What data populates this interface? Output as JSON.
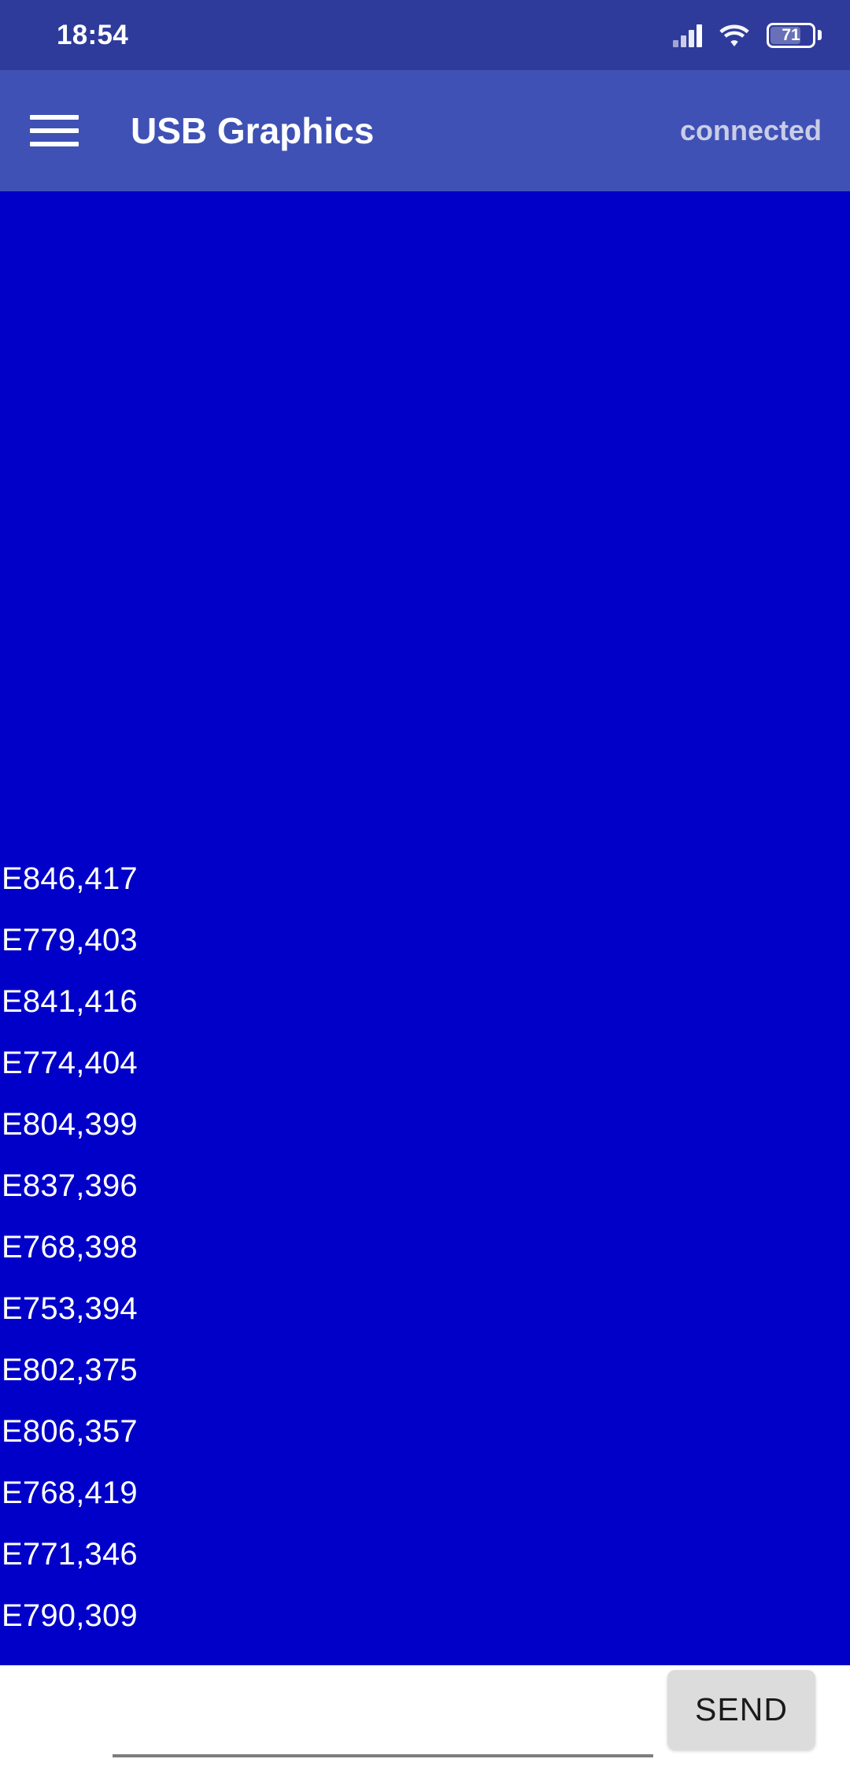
{
  "status_bar": {
    "time": "18:54",
    "battery_level": "71",
    "signal_icon": "signal-bars-icon",
    "wifi_icon": "wifi-icon",
    "battery_icon": "battery-icon",
    "background_color": "#2E3B9B"
  },
  "app_bar": {
    "menu_icon": "hamburger-menu-icon",
    "title": "USB Graphics",
    "connection_status": "connected",
    "background_color": "#3F51B5"
  },
  "content": {
    "background_color": "#0000C8",
    "text_color": "#FFFFFF",
    "log_lines": [
      "E846,417",
      "E779,403",
      "E841,416",
      "E774,404",
      "E804,399",
      "E837,396",
      "E768,398",
      "E753,394",
      "E802,375",
      "E806,357",
      "E768,419",
      "E771,346",
      "E790,309"
    ]
  },
  "input_bar": {
    "message_value": "",
    "message_placeholder": "",
    "send_label": "SEND",
    "send_background_color": "#DCDCDC"
  }
}
